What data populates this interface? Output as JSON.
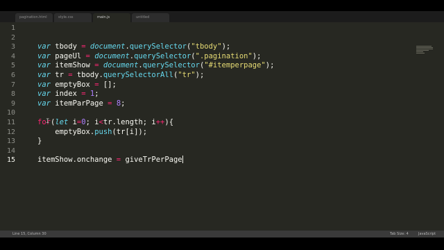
{
  "tabs": [
    {
      "label": "pagination.html"
    },
    {
      "label": "style.css"
    },
    {
      "label": "main.js"
    },
    {
      "label": "untitled"
    }
  ],
  "active_tab_index": 2,
  "editor": {
    "current_line": "15",
    "line_numbers": [
      "1",
      "2",
      "3",
      "4",
      "5",
      "6",
      "7",
      "8",
      "9",
      "10",
      "11",
      "12",
      "13",
      "14",
      "15"
    ],
    "tokens": {
      "var": "var",
      "let": "let",
      "for": "for",
      "document": "document",
      "querySelector": "querySelector",
      "querySelectorAll": "querySelectorAll",
      "push": "push",
      "str_tbody": "\"tbody\"",
      "str_pagination": "\".pagination\"",
      "str_itemperpage": "\"#itemperpage\"",
      "str_tr": "\"tr\"",
      "num_0": "0",
      "num_1": "1",
      "num_8": "8",
      "eq": "=",
      "lt": "<",
      "inc": "++",
      "l3_name": " tbody ",
      "l4_name": " pageUl ",
      "l5_name": " itemShow ",
      "l6_name": " tr ",
      "l6_tbody": "tbody.",
      "l7_name": " emptyBox ",
      "l7_val": " [];",
      "l8_name": " index ",
      "l9_name": " itemParPage ",
      "semi": ";",
      "dot": ".",
      "open": "(",
      "close": ");",
      "l11_open": "(",
      "l11_i": " i",
      "l11_mid": "; i",
      "l11_len": "tr.length; i",
      "l11_end": "){",
      "l12_indent": "    emptyBox.",
      "l12_args": "(tr[i]);",
      "l13_brace": "}",
      "l15_text": "itemShow.onchange ",
      "l15_val": " giveTrPerPage"
    }
  },
  "statusbar": {
    "position": "Line 15, Column 30",
    "tab_size": "Tab Size: 4",
    "syntax": "JavaScript"
  },
  "colors": {
    "background": "#272822",
    "keyword": "#66d9ef",
    "string": "#e6db74",
    "number": "#ae81ff",
    "operator": "#f92672",
    "text": "#f8f8f2"
  }
}
